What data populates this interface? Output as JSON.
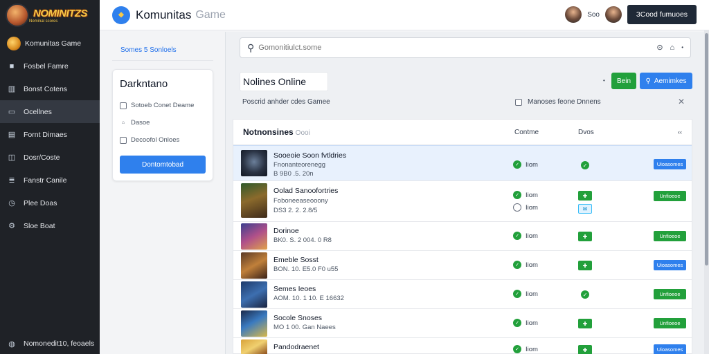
{
  "sidebar": {
    "logo_text": "NOMINITZS",
    "logo_sub": "Nominal scores",
    "items": [
      {
        "label": "Komunitas Game",
        "icon": "coin-icon"
      },
      {
        "label": "Fosbel Famre",
        "icon": "controller-icon"
      },
      {
        "label": "Bonst Cotens",
        "icon": "bank-icon"
      },
      {
        "label": "Ocellnes",
        "icon": "monitor-icon"
      },
      {
        "label": "Fornt Dimaes",
        "icon": "file-icon"
      },
      {
        "label": "Dosr/Coste",
        "icon": "book-icon"
      },
      {
        "label": "Fanstr Canile",
        "icon": "list-icon"
      },
      {
        "label": "Plee Doas",
        "icon": "clock-icon"
      },
      {
        "label": "Sloe Boat",
        "icon": "gear-icon"
      }
    ],
    "footer": "Nomonedit10, feoaels"
  },
  "topbar": {
    "brand": "Komunitas",
    "brand_sub": "Game",
    "user_text": "Soo",
    "button_label": "3Cood fumuoes"
  },
  "left_panel": {
    "link": "Somes 5 Sonloels",
    "card_title": "Darkntano",
    "items": [
      "Sotoeb Conet Deame",
      "Dasoe",
      "Decoofol Onloes"
    ],
    "button": "Dontomtobad"
  },
  "main": {
    "search_placeholder": "Gomonitiulct.some",
    "section_title": "Nolines Online",
    "green_button": "Bein",
    "blue_button": "Aemimkes",
    "sub_label": "Poscrid anhder cdes Gamee",
    "filter_label": "Manoses feone Dnnens",
    "table": {
      "title": "Notnonsines",
      "title_sub": "Oooi",
      "col1": "Contme",
      "col2": "Dvos",
      "rows": [
        {
          "name": "Sooeoie Soon fvtldries",
          "sub": "Fnonanteorenegg",
          "meta": "B 9B0 .5. 20n",
          "status": "Iiom",
          "action": "Uioasomes"
        },
        {
          "name": "Oolad Sanoofortries",
          "sub": "Foboneeaseooony",
          "meta": "DS3 2. 2. 2.8/5",
          "status": "Iiom",
          "status2": "Iiom",
          "action": "Unfioeoe"
        },
        {
          "name": "Dorinoe",
          "sub": "",
          "meta": "BK0. S. 2 004. 0 R8",
          "status": "Iiom",
          "action": "Unfioeoe"
        },
        {
          "name": "Emeble Sosst",
          "sub": "",
          "meta": "BON. 10. E5.0 F0 u55",
          "status": "Iiom",
          "action": "Uioasomes"
        },
        {
          "name": "Semes Ieoes",
          "sub": "",
          "meta": "AOM. 10. 1 10. E 16632",
          "status": "Iiom",
          "action": "Unfioeoe"
        },
        {
          "name": "Socole Snoses",
          "sub": "",
          "meta": "MO 1 00. Gan Naees",
          "status": "Iiom",
          "action": "Unfioeoe"
        },
        {
          "name": "Pandodraenet",
          "sub": "",
          "meta": "",
          "status": "Iiom",
          "action": "Uioasomes"
        }
      ]
    }
  },
  "colors": {
    "sidebar_bg": "#1f2227",
    "accent_blue": "#2f80ed",
    "accent_green": "#22a03b"
  }
}
